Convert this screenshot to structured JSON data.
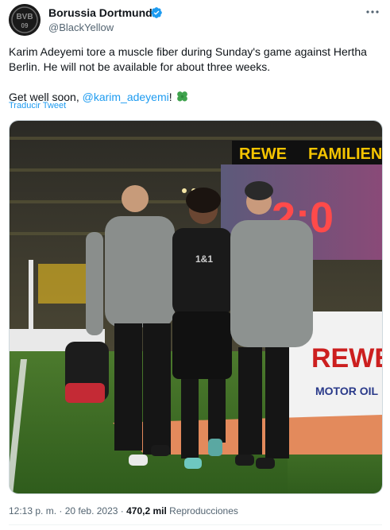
{
  "author": {
    "name": "Borussia Dortmund",
    "handle": "@BlackYellow",
    "avatar_text": "BVB\n09"
  },
  "tweet": {
    "line1": "Karim Adeyemi tore a muscle fiber during Sunday's game against Hertha Berlin. He will not be available for about three weeks.",
    "line2_prefix": "Get well soon, ",
    "mention": "@karim_adeyemi",
    "line2_suffix": "! ",
    "emoji": "clover",
    "translate_label": "Traducir Tweet"
  },
  "media": {
    "board_left": "REWE",
    "board_right": "FAMILIEN",
    "score": "2:0",
    "ad_brand": "REWE",
    "ad_sub": "MOTOR OIL",
    "shirt_text": "1&1"
  },
  "meta": {
    "time": "12:13 p. m.",
    "sep1": " · ",
    "date": "20 feb. 2023",
    "sep2": " · ",
    "views": "470,2 mil",
    "views_label": " Reproducciones"
  },
  "colors": {
    "accent": "#1d9bf0",
    "bvb_yellow": "#fde100"
  }
}
